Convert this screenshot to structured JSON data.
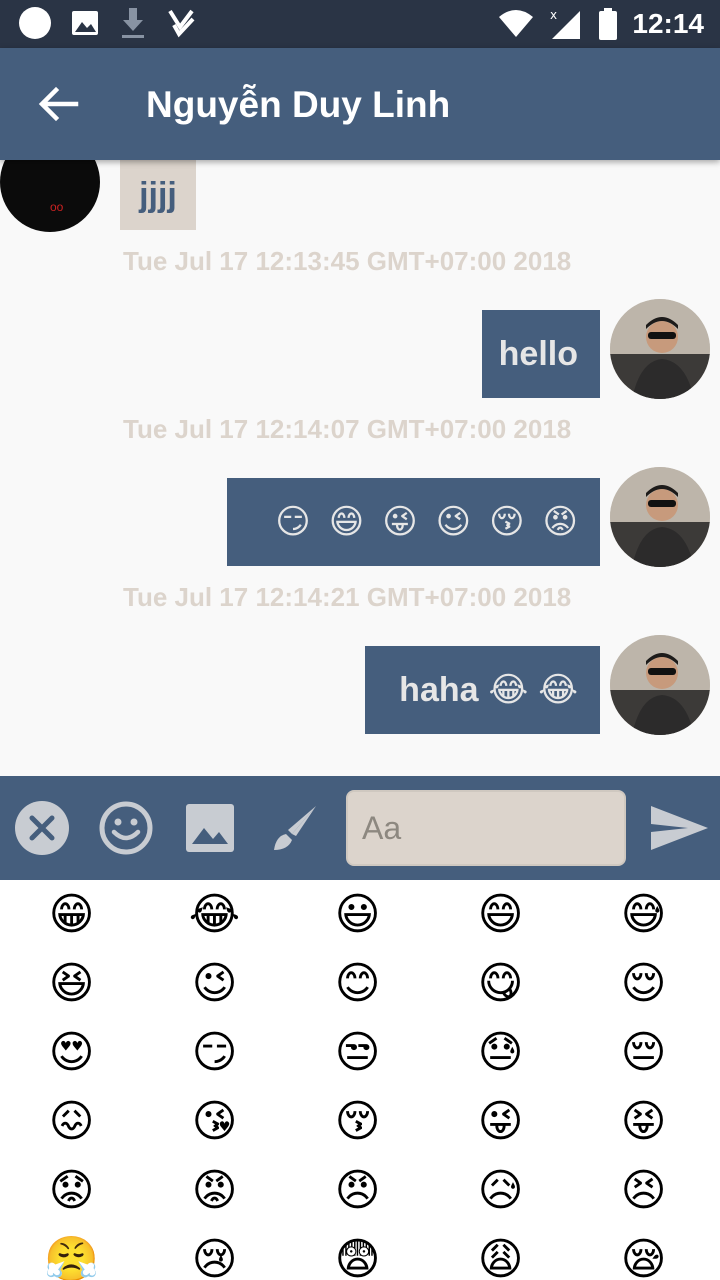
{
  "status_bar": {
    "time": "12:14"
  },
  "app_bar": {
    "title": "Nguyễn Duy Linh"
  },
  "messages": [
    {
      "direction": "in",
      "text": "jjjj"
    },
    {
      "timestamp": "Tue Jul 17 12:13:45 GMT+07:00 2018"
    },
    {
      "direction": "out",
      "text": "hello"
    },
    {
      "timestamp": "Tue Jul 17 12:14:07 GMT+07:00 2018"
    },
    {
      "direction": "out",
      "text": "",
      "emojis": [
        "😏",
        "😄",
        "😜",
        "😉",
        "😚",
        "😡"
      ]
    },
    {
      "timestamp": "Tue Jul 17 12:14:21 GMT+07:00 2018"
    },
    {
      "direction": "out",
      "text": "haha",
      "emojis": [
        "😂",
        "😂"
      ]
    }
  ],
  "input": {
    "placeholder": "Aa"
  },
  "toolbar_icons": [
    "close-icon",
    "emoji-icon",
    "image-icon",
    "brush-icon",
    "send-icon"
  ],
  "emoji_grid": [
    "😁",
    "😂",
    "😃",
    "😄",
    "😅",
    "😆",
    "😉",
    "😊",
    "😋",
    "😌",
    "😍",
    "😏",
    "😒",
    "😓",
    "😔",
    "😖",
    "😘",
    "😚",
    "😜",
    "😝",
    "😟",
    "😡",
    "😠",
    "😥",
    "😣",
    "😤",
    "😢",
    "😨",
    "😩",
    "😪"
  ],
  "colors": {
    "primary": "#455e7d",
    "status_bar": "#2a3445",
    "bubble_in": "#dcd4cc",
    "timestamp": "#dcd4cc"
  }
}
